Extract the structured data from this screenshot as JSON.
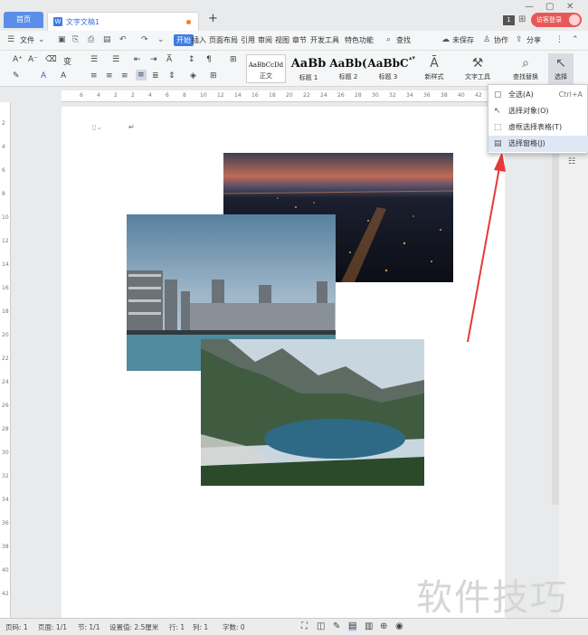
{
  "titlebar": {
    "home_tab": "首页",
    "doc_tab": "文字文稿1",
    "add_tab": "+",
    "doc_icon": "W",
    "page_count_badge": "1",
    "login_label": "访客登录"
  },
  "menu": {
    "file": "文件",
    "items": [
      "开始",
      "插入",
      "页面布局",
      "引用",
      "审阅",
      "视图",
      "章节",
      "开发工具",
      "特色功能"
    ],
    "search": "查找",
    "unsaved": "未保存",
    "collab": "协作",
    "share": "分享"
  },
  "ribbon": {
    "styles": [
      {
        "sample": "AaBbCcDd",
        "name": "正文"
      },
      {
        "sample": "AaBb",
        "name": "标题 1"
      },
      {
        "sample": "AaBb(",
        "name": "标题 2"
      },
      {
        "sample": "AaBbC",
        "name": "标题 3"
      }
    ],
    "new_style": "新样式",
    "text_tools": "文字工具",
    "find_replace": "查找替换",
    "select": "选择"
  },
  "ruler_h": [
    "6",
    "4",
    "2",
    "2",
    "4",
    "6",
    "8",
    "10",
    "12",
    "14",
    "16",
    "18",
    "20",
    "22",
    "24",
    "26",
    "28",
    "30",
    "32",
    "34",
    "36",
    "38",
    "40",
    "42"
  ],
  "ruler_v": [
    "2",
    "4",
    "6",
    "8",
    "10",
    "12",
    "14",
    "16",
    "18",
    "20",
    "22",
    "24",
    "26",
    "28",
    "30",
    "32",
    "34",
    "36",
    "38",
    "40",
    "42"
  ],
  "dropdown": [
    {
      "icon": "▢",
      "label": "全选(A)",
      "shortcut": "Ctrl+A"
    },
    {
      "icon": "↖",
      "label": "选择对象(O)",
      "shortcut": ""
    },
    {
      "icon": "⬚",
      "label": "虚框选择表格(T)",
      "shortcut": ""
    },
    {
      "icon": "▤",
      "label": "选择窗格(J)",
      "shortcut": ""
    }
  ],
  "status": {
    "page_num": "页码: 1",
    "pages": "页面: 1/1",
    "section": "节: 1/1",
    "setting": "设置值: 2.5厘米",
    "row": "行: 1",
    "col": "列: 1",
    "words": "字数: 0"
  },
  "watermark": "软件技巧",
  "colors": {
    "accent": "#3d7ce6",
    "arrow": "#e53935",
    "login": "#e85858"
  }
}
